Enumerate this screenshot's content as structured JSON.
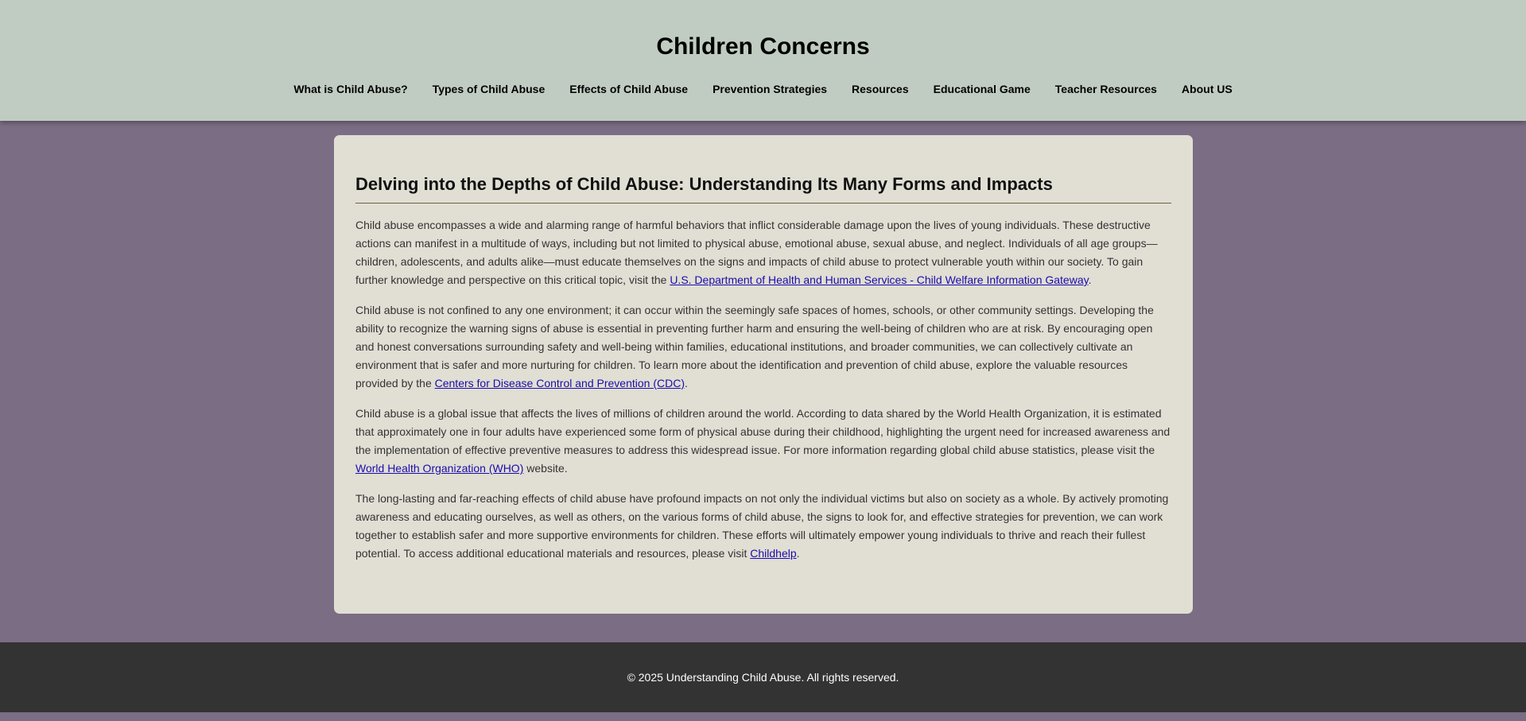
{
  "header": {
    "site_title": "Children Concerns",
    "nav": [
      {
        "label": "What is Child Abuse?"
      },
      {
        "label": "Types of Child Abuse"
      },
      {
        "label": "Effects of Child Abuse"
      },
      {
        "label": "Prevention Strategies"
      },
      {
        "label": "Resources"
      },
      {
        "label": "Educational Game"
      },
      {
        "label": "Teacher Resources"
      },
      {
        "label": "About US"
      }
    ]
  },
  "main": {
    "heading": "Delving into the Depths of Child Abuse: Understanding Its Many Forms and Impacts",
    "paragraphs": [
      {
        "before": "Child abuse encompasses a wide and alarming range of harmful behaviors that inflict considerable damage upon the lives of young individuals. These destructive actions can manifest in a multitude of ways, including but not limited to physical abuse, emotional abuse, sexual abuse, and neglect. Individuals of all age groups—children, adolescents, and adults alike—must educate themselves on the signs and impacts of child abuse to protect vulnerable youth within our society. To gain further knowledge and perspective on this critical topic, visit the ",
        "link": "U.S. Department of Health and Human Services - Child Welfare Information Gateway",
        "after": "."
      },
      {
        "before": "Child abuse is not confined to any one environment; it can occur within the seemingly safe spaces of homes, schools, or other community settings. Developing the ability to recognize the warning signs of abuse is essential in preventing further harm and ensuring the well-being of children who are at risk. By encouraging open and honest conversations surrounding safety and well-being within families, educational institutions, and broader communities, we can collectively cultivate an environment that is safer and more nurturing for children. To learn more about the identification and prevention of child abuse, explore the valuable resources provided by the ",
        "link": "Centers for Disease Control and Prevention (CDC)",
        "after": "."
      },
      {
        "before": "Child abuse is a global issue that affects the lives of millions of children around the world. According to data shared by the World Health Organization, it is estimated that approximately one in four adults have experienced some form of physical abuse during their childhood, highlighting the urgent need for increased awareness and the implementation of effective preventive measures to address this widespread issue. For more information regarding global child abuse statistics, please visit the ",
        "link": "World Health Organization (WHO)",
        "after": " website."
      },
      {
        "before": "The long-lasting and far-reaching effects of child abuse have profound impacts on not only the individual victims but also on society as a whole. By actively promoting awareness and educating ourselves, as well as others, on the various forms of child abuse, the signs to look for, and effective strategies for prevention, we can work together to establish safer and more supportive environments for children. These efforts will ultimately empower young individuals to thrive and reach their fullest potential. To access additional educational materials and resources, please visit ",
        "link": "Childhelp",
        "after": "."
      }
    ]
  },
  "footer": {
    "copyright": "© 2025 Understanding Child Abuse. All rights reserved."
  },
  "colors": {
    "header_bg": "#c0ccc1",
    "page_bg": "#7b6d84",
    "card_bg": "#e1ded4",
    "footer_bg": "#333333",
    "link": "#1a0dab"
  }
}
